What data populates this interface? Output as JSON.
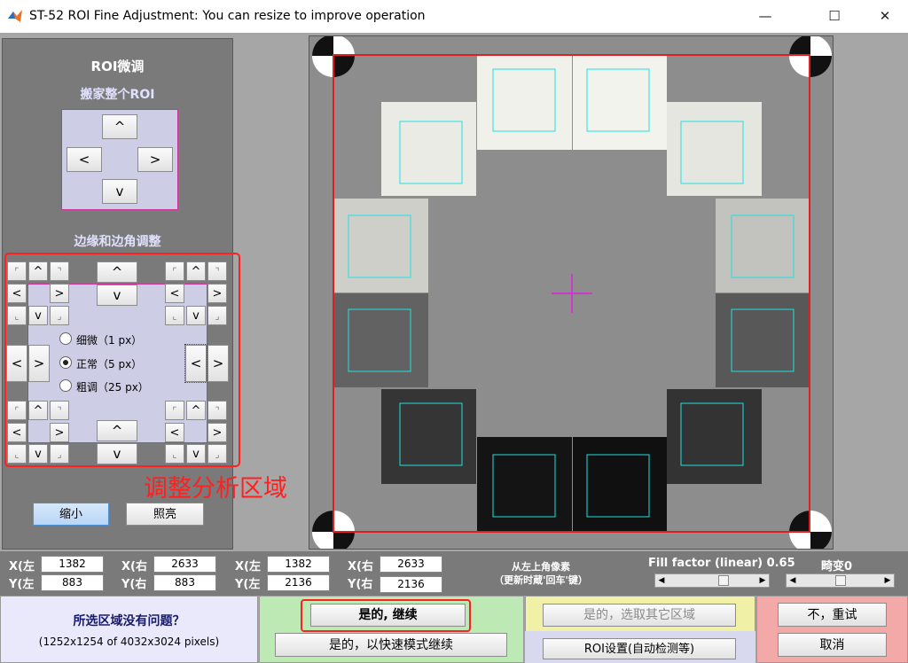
{
  "window": {
    "title": "ST-52 ROI Fine Adjustment: You can resize to improve operation",
    "minimize": "—",
    "maximize": "☐",
    "close": "✕"
  },
  "left": {
    "title": "ROI微调",
    "move_label": "搬家整个ROI",
    "edge_label": "边缘和边角调整",
    "arrow_up": "^",
    "arrow_down": "v",
    "arrow_left": "<",
    "arrow_right": ">",
    "corner_tl": "⌜",
    "corner_tr": "⌝",
    "corner_bl": "⌞",
    "corner_br": "⌟",
    "radios": [
      {
        "label": "细微（1 px）",
        "selected": false
      },
      {
        "label": "正常（5 px）",
        "selected": true
      },
      {
        "label": "粗调（25 px）",
        "selected": false
      }
    ],
    "annotation": "调整分析区域",
    "zoom_btn": "缩小",
    "light_btn": "照亮"
  },
  "coords": {
    "x_left_label": "X(左",
    "y_left_label": "Y(左",
    "x_right_label": "X(右",
    "y_right_label": "Y(右",
    "x_left_top": "1382",
    "y_left_top": "883",
    "x_right_top": "2633",
    "y_right_top": "883",
    "x_left_bot": "1382",
    "y_left_bot": "2136",
    "x_right_bot": "2633",
    "y_right_bot": "2136",
    "pixel_note1": "从左上角像素",
    "pixel_note2": "（更新时蔵'回车'键）",
    "fill_label": "Fill factor (linear) 0.65",
    "distort_label": "畸变0",
    "fill_value": 0.65,
    "distort_value": 0.5
  },
  "bottom": {
    "question": "所选区域没有问题？",
    "size_info": "(1252x1254 of 4032x3024 pixels)",
    "yes_continue": "是的, 继续",
    "yes_fast": "是的，以快速模式继续",
    "yes_other": "是的，选取其它区域",
    "roi_settings": "ROI设置(自动检测等)",
    "no_retry": "不，重试",
    "cancel": "取消"
  },
  "colors": {
    "panel": "#7a7a7a",
    "lavender": "#cdcde6",
    "annotation": "#ff2020",
    "cyan": "#20e0e0",
    "crosshair": "#e020e0"
  }
}
